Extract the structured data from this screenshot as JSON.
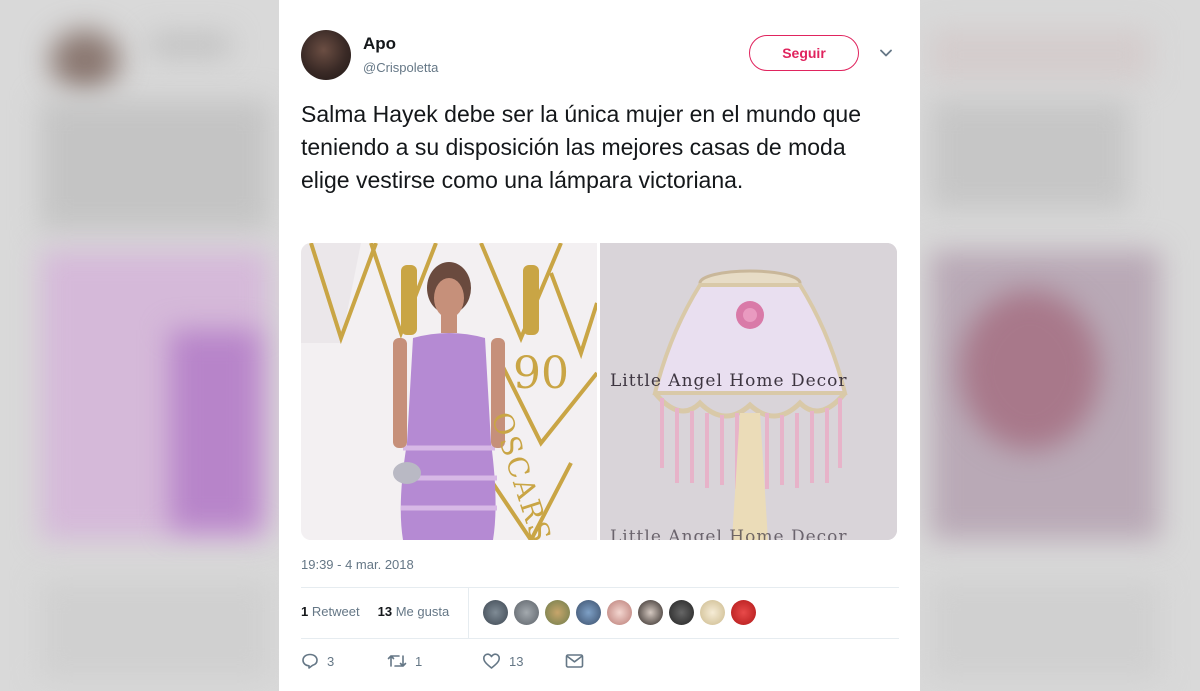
{
  "tweet": {
    "author_name": "Apo",
    "author_handle": "@Crispoletta",
    "follow_label": "Seguir",
    "text": "Salma Hayek debe ser la única mujer en el mundo que teniendo a su disposición las mejores casas de moda elige vestirse como una lámpara victoriana.",
    "media": {
      "left_logo_text": "OSCARS",
      "left_number_text": "90",
      "right_watermark": "Little Angel Home Decor",
      "right_watermark_bottom": "Little Angel Home Decor"
    },
    "timestamp": "19:39 - 4 mar. 2018",
    "retweets_count": "1",
    "retweets_label": "Retweet",
    "likes_count": "13",
    "likes_label": "Me gusta",
    "reply_count": "3",
    "retweet_action_count": "1",
    "like_action_count": "13"
  },
  "icons": [
    "chevron-down-icon",
    "reply-icon",
    "retweet-icon",
    "heart-icon",
    "message-icon"
  ],
  "colors": {
    "accent": "#e0245e",
    "text": "#14171a",
    "muted": "#657786",
    "dress": "#b58ad3"
  }
}
